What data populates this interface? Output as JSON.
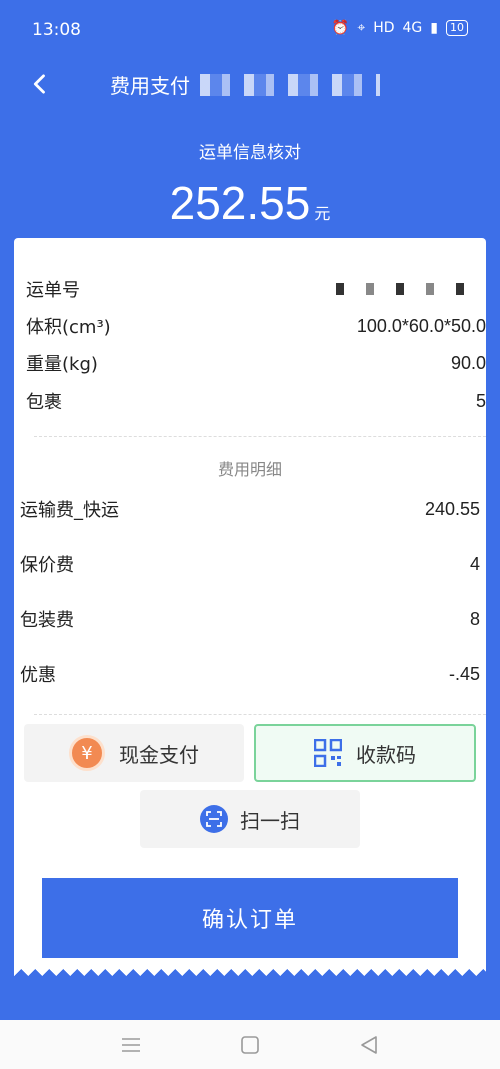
{
  "status": {
    "time": "13:08",
    "network": "HD",
    "signal": "4G",
    "battery": "10"
  },
  "nav": {
    "title": "费用支付"
  },
  "header": {
    "subtitle": "运单信息核对",
    "amount": "252.55",
    "unit": "元"
  },
  "info": [
    {
      "label": "运单号",
      "value": ""
    },
    {
      "label": "体积(cm³)",
      "value": "100.0*60.0*50.0"
    },
    {
      "label": "重量(kg)",
      "value": "90.0"
    },
    {
      "label": "包裹",
      "value": "5"
    }
  ],
  "fee_section": {
    "title": "费用明细"
  },
  "fees": [
    {
      "label": "运输费_快运",
      "value": "240.55"
    },
    {
      "label": "保价费",
      "value": "4"
    },
    {
      "label": "包装费",
      "value": "8"
    },
    {
      "label": "优惠",
      "value": "-.45"
    }
  ],
  "actions": {
    "cash_label": "现金支付",
    "qr_label": "收款码",
    "scan_label": "扫一扫",
    "submit_label": "确认订单"
  },
  "colors": {
    "primary": "#3d6fe8",
    "qr_border": "#7ad39a",
    "cash_icon": "#f28a52"
  }
}
